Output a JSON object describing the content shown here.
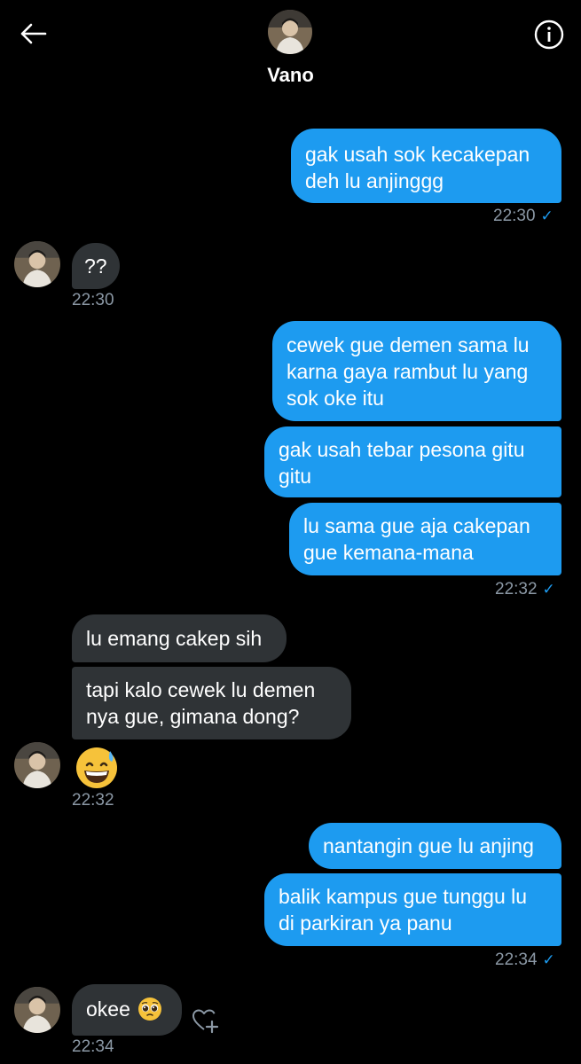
{
  "header": {
    "contact_name": "Vano"
  },
  "icons": {
    "back": "arrow-left-icon",
    "info": "info-icon",
    "read": "checkmark-icon",
    "react": "heart-plus-icon"
  },
  "colors": {
    "outgoing_bubble": "#1d9bf0",
    "incoming_bubble": "#2f3336",
    "background": "#000000",
    "timestamp": "#8b98a5"
  },
  "messages": [
    {
      "from": "me",
      "text": "gak usah sok kecakepan\ndeh lu anjinggg"
    },
    {
      "from": "me",
      "time": "22:30"
    },
    {
      "from": "Vano",
      "text": "??",
      "time": "22:30"
    },
    {
      "from": "me",
      "text": "cewek gue demen sama lu\nkarna gaya rambut lu yang\nsok oke itu"
    },
    {
      "from": "me",
      "text": "gak usah tebar pesona gitu\ngitu"
    },
    {
      "from": "me",
      "text": "lu sama gue aja cakepan\ngue kemana-mana",
      "time": "22:32"
    },
    {
      "from": "Vano",
      "text": "lu emang cakep sih"
    },
    {
      "from": "Vano",
      "text": "tapi kalo cewek lu demen\nnya gue, gimana dong?"
    },
    {
      "from": "Vano",
      "emoji": "grinning-face-with-sweat",
      "time": "22:32"
    },
    {
      "from": "me",
      "text": "nantangin gue lu anjing"
    },
    {
      "from": "me",
      "text": "balik kampus gue tunggu lu\ndi parkiran ya panu",
      "time": "22:34"
    },
    {
      "from": "Vano",
      "text": "okee",
      "emoji": "pleading-face",
      "time": "22:34"
    }
  ]
}
